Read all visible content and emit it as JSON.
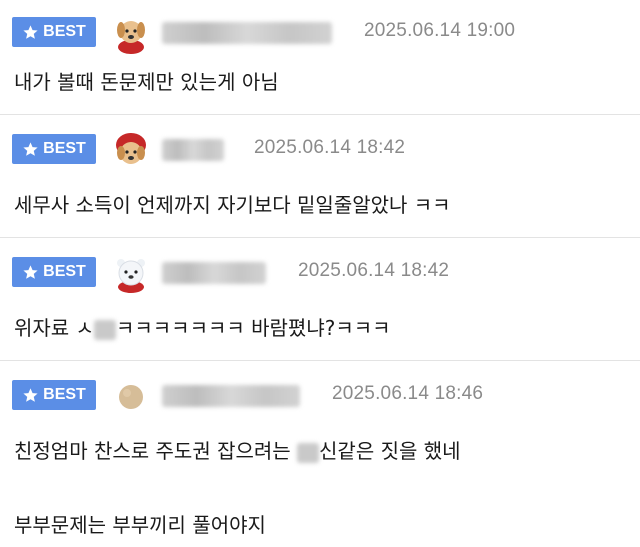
{
  "comments": [
    {
      "badge": "BEST",
      "avatar_icon": "puppy-icon",
      "time": "2025.06.14 19:00",
      "lines": [
        "내가 볼때 돈문제만 있는게 아님"
      ]
    },
    {
      "badge": "BEST",
      "avatar_icon": "puppy-red-hood-icon",
      "time": "2025.06.14 18:42",
      "lines": [
        "세무사 소득이 언제까지 자기보다 밑일줄알았나 ㅋㅋ"
      ]
    },
    {
      "badge": "BEST",
      "avatar_icon": "polar-bear-icon",
      "time": "2025.06.14 18:42",
      "text_pre": "위자료 ㅅ",
      "text_post": "ㅋㅋㅋㅋㅋㅋㅋ 바람폈냐?ㅋㅋㅋ"
    },
    {
      "badge": "BEST",
      "avatar_icon": "beige-circle-icon",
      "time": "2025.06.14 18:46",
      "text_pre": "친정엄마 찬스로 주도권 잡으려는 ",
      "text_post": "신같은 짓을 했네",
      "line2": "부부문제는 부부끼리 풀어야지"
    }
  ]
}
